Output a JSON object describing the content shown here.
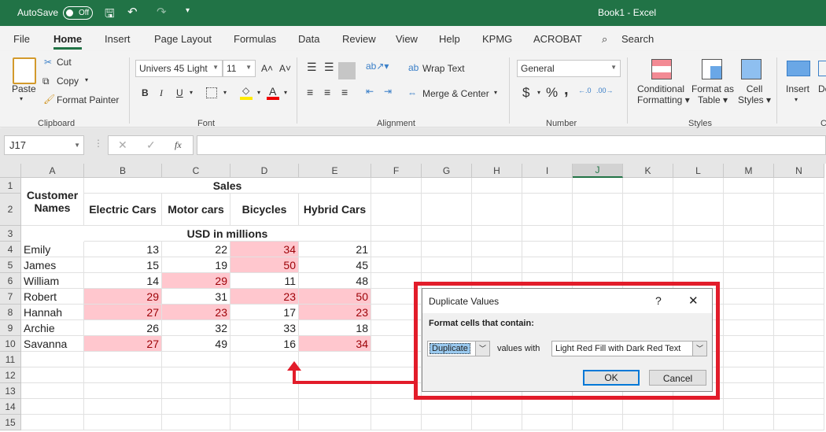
{
  "titlebar": {
    "autosave": "AutoSave",
    "toggle": "Off",
    "title": "Book1  -  Excel"
  },
  "tabs": [
    "File",
    "Home",
    "Insert",
    "Page Layout",
    "Formulas",
    "Data",
    "Review",
    "View",
    "Help",
    "KPMG",
    "ACROBAT",
    "Search"
  ],
  "ribbon": {
    "clipboard": {
      "paste": "Paste",
      "cut": "Cut",
      "copy": "Copy",
      "format_painter": "Format Painter",
      "label": "Clipboard"
    },
    "font": {
      "name": "Univers 45 Light",
      "size": "11",
      "bold": "B",
      "italic": "I",
      "underline": "U",
      "label": "Font"
    },
    "alignment": {
      "wrap": "Wrap Text",
      "merge": "Merge & Center",
      "label": "Alignment"
    },
    "number": {
      "format": "General",
      "currency": "$",
      "percent": "%",
      "comma": ",",
      "label": "Number"
    },
    "styles": {
      "conditional": "Conditional",
      "conditional2": "Formatting",
      "format_table": "Format as",
      "format_table2": "Table",
      "cell_styles": "Cell",
      "cell_styles2": "Styles",
      "label": "Styles"
    },
    "cells": {
      "insert": "Insert",
      "delete": "De",
      "label": "C"
    }
  },
  "formula_bar": {
    "name_box": "J17",
    "fx": "fx",
    "value": ""
  },
  "sheet": {
    "columns": [
      "A",
      "B",
      "C",
      "D",
      "E",
      "F",
      "G",
      "H",
      "I",
      "J",
      "K",
      "L",
      "M",
      "N"
    ],
    "rows": [
      "1",
      "2",
      "3",
      "4",
      "5",
      "6",
      "7",
      "8",
      "9",
      "10",
      "11",
      "12",
      "13",
      "14",
      "15"
    ],
    "sales": "Sales",
    "customer_names": "Customer Names",
    "headers": [
      "Electric Cars",
      "Motor cars",
      "Bicycles",
      "Hybrid Cars"
    ],
    "units": "USD in millions",
    "data": [
      {
        "name": "Emily",
        "values": [
          13,
          22,
          34,
          21
        ],
        "dup": [
          false,
          false,
          true,
          false
        ]
      },
      {
        "name": "James",
        "values": [
          15,
          19,
          50,
          45
        ],
        "dup": [
          false,
          false,
          true,
          false
        ]
      },
      {
        "name": "William",
        "values": [
          14,
          29,
          11,
          48
        ],
        "dup": [
          false,
          true,
          false,
          false
        ]
      },
      {
        "name": "Robert",
        "values": [
          29,
          31,
          23,
          50
        ],
        "dup": [
          true,
          false,
          true,
          true
        ]
      },
      {
        "name": "Hannah",
        "values": [
          27,
          23,
          17,
          23
        ],
        "dup": [
          true,
          true,
          false,
          true
        ]
      },
      {
        "name": "Archie",
        "values": [
          26,
          32,
          33,
          18
        ],
        "dup": [
          false,
          false,
          false,
          false
        ]
      },
      {
        "name": "Savanna",
        "values": [
          27,
          49,
          16,
          34
        ],
        "dup": [
          true,
          false,
          false,
          true
        ]
      }
    ]
  },
  "dialog": {
    "title": "Duplicate Values",
    "help": "?",
    "close": "✕",
    "prompt": "Format cells that contain:",
    "type": "Duplicate",
    "values_with": "values with",
    "format": "Light Red Fill with Dark Red Text",
    "ok": "OK",
    "cancel": "Cancel"
  },
  "colors": {
    "excel_green": "#217346",
    "dup_fill": "#ffc7ce",
    "dup_text": "#9c0006",
    "annotation": "#e21c2a"
  }
}
